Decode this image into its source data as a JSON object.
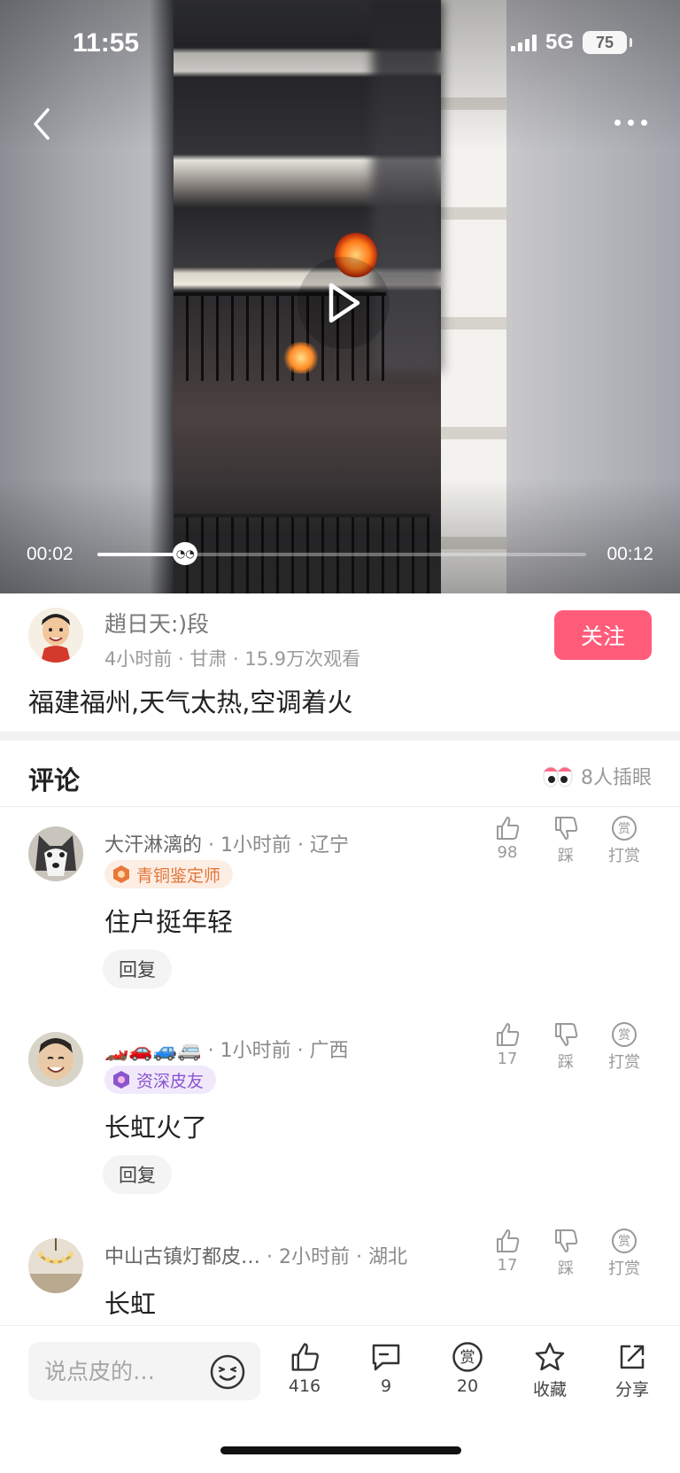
{
  "status_bar": {
    "time": "11:55",
    "network": "5G",
    "battery": "75"
  },
  "video": {
    "current_time": "00:02",
    "duration": "00:12",
    "progress": 0.18
  },
  "author": {
    "name": "趙日天:)段",
    "meta": "4小时前 · 甘肃 · 15.9万次观看",
    "follow_label": "关注"
  },
  "post": {
    "title": "福建福州,天气太热,空调着火"
  },
  "comments_section": {
    "title": "评论",
    "watching": "8人插眼"
  },
  "comment_actions": {
    "dislike_label": "踩",
    "reward_label": "打赏",
    "reply_label": "回复",
    "reward_icon_char": "赏"
  },
  "comments": [
    {
      "user": "大汗淋漓的",
      "time": "1小时前",
      "location": "辽宁",
      "badge": "青铜鉴定师",
      "text": "住户挺年轻",
      "likes": "98"
    },
    {
      "user": "🏎️🚗🚙🚐",
      "time": "1小时前",
      "location": "广西",
      "badge": "资深皮友",
      "text": "长虹火了",
      "likes": "17"
    },
    {
      "user": "中山古镇灯都皮…",
      "time": "2小时前",
      "location": "湖北",
      "text": "长虹",
      "likes": "17"
    }
  ],
  "bottom_bar": {
    "input_placeholder": "说点皮的…",
    "like_count": "416",
    "comment_count": "9",
    "reward_count": "20",
    "reward_char": "赏",
    "favorite_label": "收藏",
    "share_label": "分享"
  },
  "colors": {
    "accent": "#ff5c7a",
    "bronze": "#e2753a",
    "purple": "#8a55cf"
  }
}
